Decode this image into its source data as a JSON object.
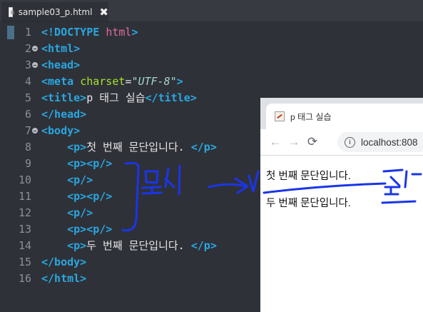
{
  "editor": {
    "tab": {
      "filename": "sample03_p.html",
      "close_glyph": "✖"
    },
    "lines": [
      {
        "n": "1",
        "fold": false,
        "tokens": [
          {
            "c": "t",
            "v": "<!DOCTYPE"
          },
          {
            "c": "b",
            "v": " "
          },
          {
            "c": "k",
            "v": "html"
          },
          {
            "c": "t",
            "v": ">"
          }
        ]
      },
      {
        "n": "2",
        "fold": true,
        "tokens": [
          {
            "c": "t",
            "v": "<html>"
          }
        ]
      },
      {
        "n": "3",
        "fold": true,
        "tokens": [
          {
            "c": "t",
            "v": "<head>"
          }
        ]
      },
      {
        "n": "4",
        "fold": false,
        "tokens": [
          {
            "c": "t",
            "v": "<meta"
          },
          {
            "c": "b",
            "v": " "
          },
          {
            "c": "a",
            "v": "charset"
          },
          {
            "c": "b",
            "v": "="
          },
          {
            "c": "s",
            "v": "\"UTF-8\""
          },
          {
            "c": "t",
            "v": ">"
          }
        ]
      },
      {
        "n": "5",
        "fold": false,
        "tokens": [
          {
            "c": "t",
            "v": "<title>"
          },
          {
            "c": "tx",
            "v": "p 태그 실습"
          },
          {
            "c": "t",
            "v": "</title>"
          }
        ]
      },
      {
        "n": "6",
        "fold": false,
        "tokens": [
          {
            "c": "t",
            "v": "</head>"
          }
        ]
      },
      {
        "n": "7",
        "fold": true,
        "tokens": [
          {
            "c": "t",
            "v": "<body>"
          }
        ]
      },
      {
        "n": "8",
        "fold": false,
        "tokens": [
          {
            "c": "b",
            "v": "    "
          },
          {
            "c": "t",
            "v": "<p>"
          },
          {
            "c": "tx",
            "v": "첫 번째 문단입니다. "
          },
          {
            "c": "t",
            "v": "</p>"
          }
        ]
      },
      {
        "n": "9",
        "fold": false,
        "tokens": [
          {
            "c": "b",
            "v": "    "
          },
          {
            "c": "t",
            "v": "<p><p/>"
          }
        ]
      },
      {
        "n": "10",
        "fold": false,
        "tokens": [
          {
            "c": "b",
            "v": "    "
          },
          {
            "c": "t",
            "v": "<p/>"
          }
        ]
      },
      {
        "n": "11",
        "fold": false,
        "tokens": [
          {
            "c": "b",
            "v": "    "
          },
          {
            "c": "t",
            "v": "<p><p/>"
          }
        ]
      },
      {
        "n": "12",
        "fold": false,
        "tokens": [
          {
            "c": "b",
            "v": "    "
          },
          {
            "c": "t",
            "v": "<p/>"
          }
        ]
      },
      {
        "n": "13",
        "fold": false,
        "tokens": [
          {
            "c": "b",
            "v": "    "
          },
          {
            "c": "t",
            "v": "<p><p/>"
          }
        ]
      },
      {
        "n": "14",
        "fold": false,
        "tokens": [
          {
            "c": "b",
            "v": "    "
          },
          {
            "c": "t",
            "v": "<p>"
          },
          {
            "c": "tx",
            "v": "두 번째 문단입니다. "
          },
          {
            "c": "t",
            "v": "</p>"
          }
        ]
      },
      {
        "n": "15",
        "fold": false,
        "tokens": [
          {
            "c": "t",
            "v": "</body>"
          }
        ]
      },
      {
        "n": "16",
        "fold": false,
        "tokens": [
          {
            "c": "t",
            "v": "</html>"
          }
        ]
      }
    ]
  },
  "browser": {
    "tab_title": "p 태그 실습",
    "back_icon": "←",
    "forward_icon": "→",
    "reload_icon": "⟳",
    "info_glyph": "i",
    "url": "localhost:808",
    "paragraphs": [
      "첫 번째 문단입니다.",
      "두 번째 문단입니다."
    ]
  },
  "annotations": {
    "left_label": "무시",
    "right_label": "줄바꿈",
    "ink_color": "#1a35e8"
  }
}
